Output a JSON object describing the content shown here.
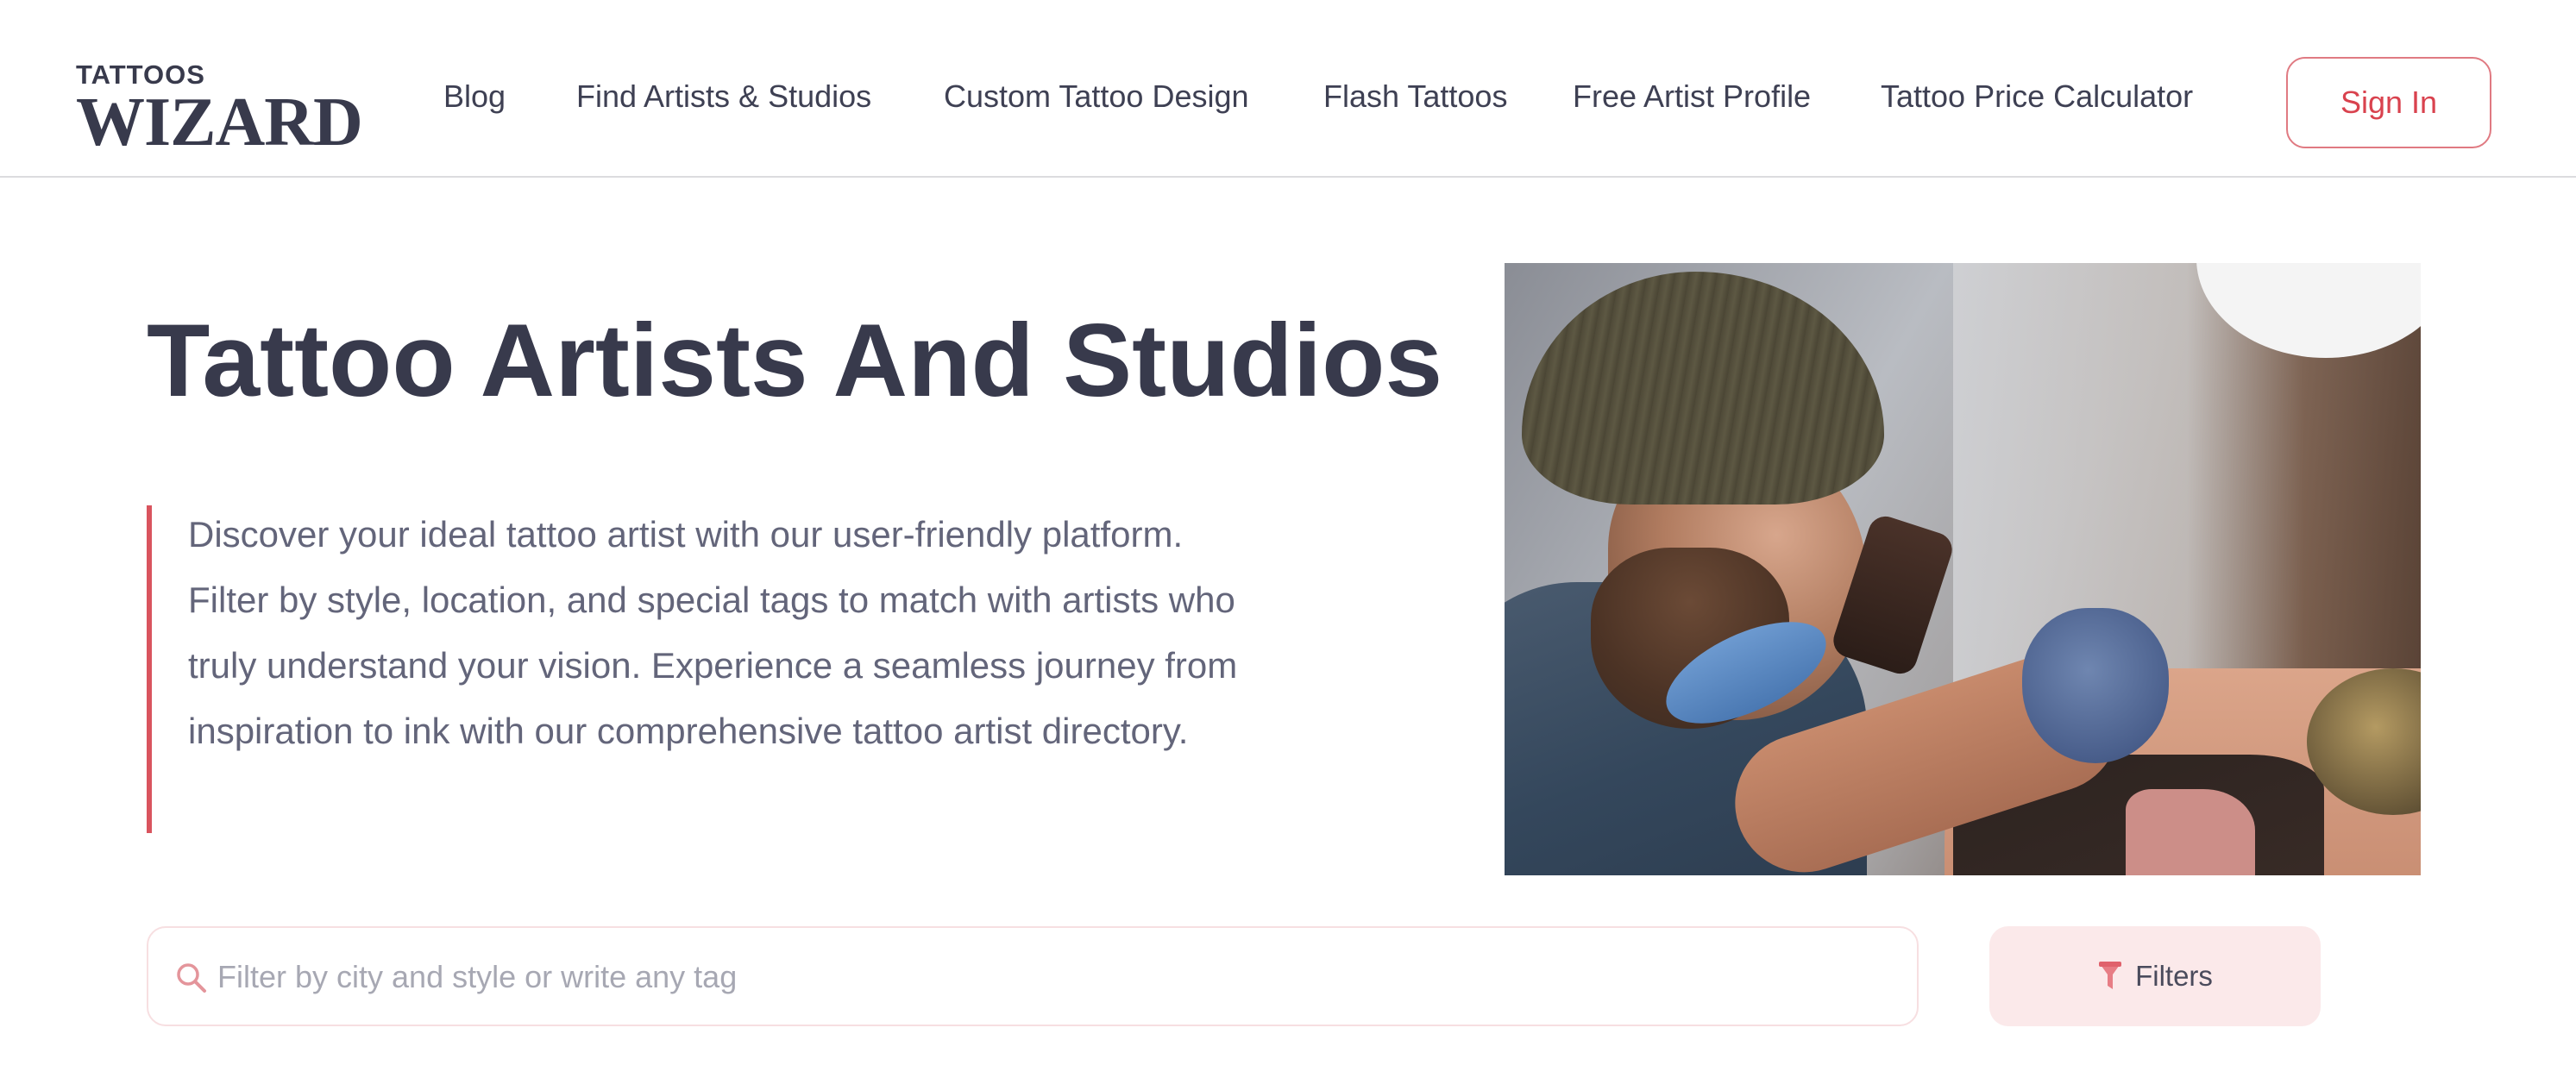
{
  "header": {
    "logo_small": "TATTOOS",
    "logo_big": "WIZARD",
    "nav": [
      {
        "label": "Blog"
      },
      {
        "label": "Find Artists & Studios"
      },
      {
        "label": "Custom Tattoo Design"
      },
      {
        "label": "Flash Tattoos"
      },
      {
        "label": "Free Artist Profile"
      },
      {
        "label": "Tattoo Price Calculator"
      }
    ],
    "signin_label": "Sign In"
  },
  "hero": {
    "title": "Tattoo Artists And Studios",
    "description": "Discover your ideal tattoo artist with our user-friendly platform. Filter by style, location, and special tags to match with artists who truly understand your vision. Experience a seamless journey from inspiration to ink with our comprehensive tattoo artist directory."
  },
  "search": {
    "placeholder": "Filter by city and style or write any tag",
    "value": "",
    "icon": "search-icon"
  },
  "filters": {
    "label": "Filters",
    "icon": "funnel-icon"
  },
  "colors": {
    "accent": "#d9424e",
    "text_dark": "#383a4c",
    "text_muted": "#63657a",
    "filters_bg": "#fbe9ea"
  }
}
